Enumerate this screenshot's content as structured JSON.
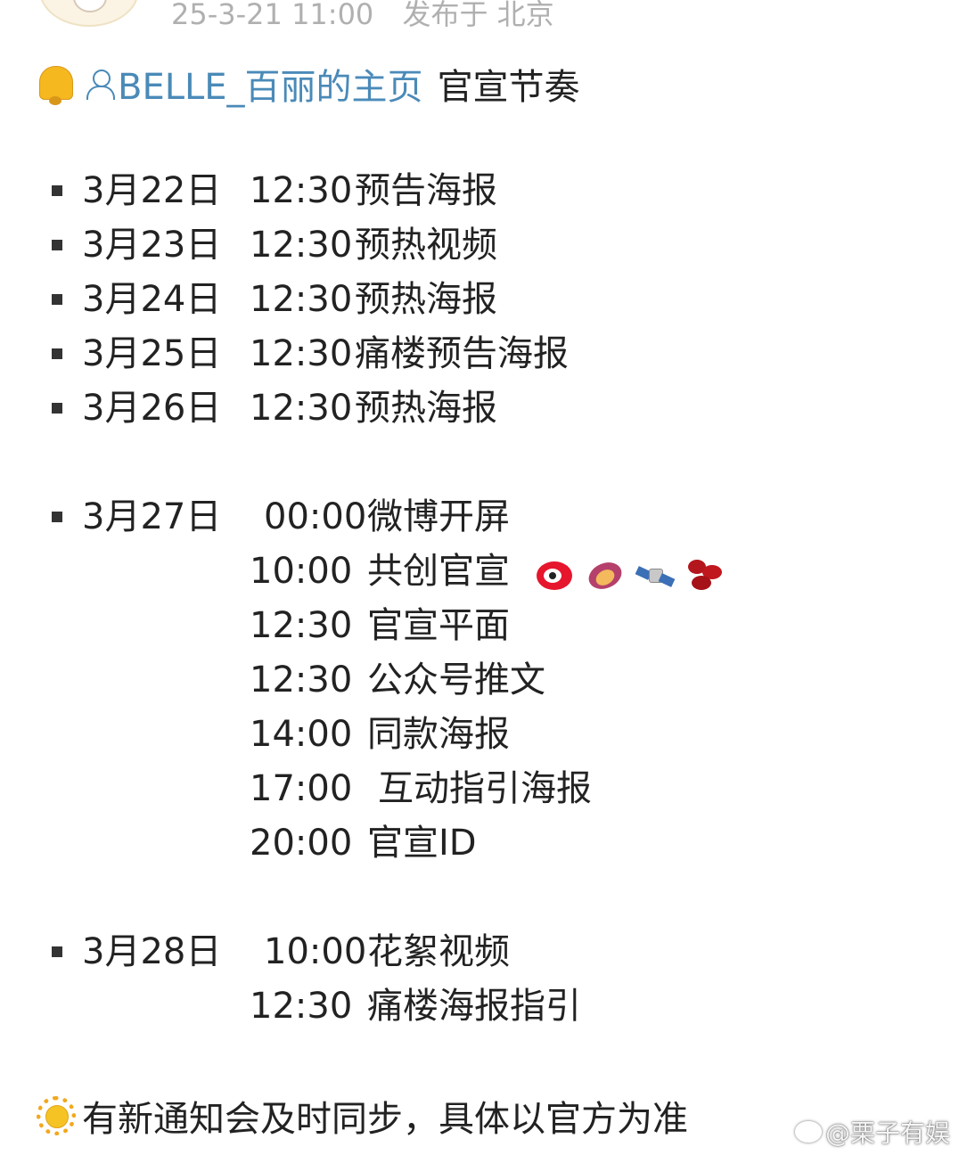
{
  "post_meta": {
    "timestamp": "25-3-21 11:00",
    "location": "发布于 北京"
  },
  "title": {
    "user_link": "BELLE_百丽的主页",
    "suffix": "官宣节奏"
  },
  "schedule_group_1": [
    {
      "date": "3月22日",
      "time": "12:30",
      "event": "预告海报"
    },
    {
      "date": "3月23日",
      "time": "12:30",
      "event": "预热视频"
    },
    {
      "date": "3月24日",
      "time": "12:30",
      "event": "预热海报"
    },
    {
      "date": "3月25日",
      "time": "12:30",
      "event": "痛楼预告海报"
    },
    {
      "date": "3月26日",
      "time": "12:30",
      "event": "预热海报"
    }
  ],
  "schedule_group_2": {
    "date": "3月27日",
    "items": [
      {
        "time": "00:00",
        "event": "微博开屏"
      },
      {
        "time": "10:00",
        "event": "共创官宣"
      },
      {
        "time": "12:30",
        "event": "官宣平面"
      },
      {
        "time": "12:30",
        "event": "公众号推文"
      },
      {
        "time": "14:00",
        "event": "同款海报"
      },
      {
        "time": "17:00",
        "event": "互动指引海报"
      },
      {
        "time": "20:00",
        "event": "官宣ID"
      }
    ],
    "emoji_icons": [
      "weibo-icon",
      "sweet-potato-icon",
      "satellite-icon",
      "red-beans-icon"
    ]
  },
  "schedule_group_3": {
    "date": "3月28日",
    "items": [
      {
        "time": "10:00",
        "event": "花絮视频"
      },
      {
        "time": "12:30",
        "event": "痛楼海报指引"
      }
    ]
  },
  "footer_note": "有新通知会及时同步，具体以官方为准",
  "watermark": "@栗子有娱",
  "colors": {
    "link": "#4a8ab8",
    "meta": "#b0b0b0",
    "text": "#222222"
  }
}
